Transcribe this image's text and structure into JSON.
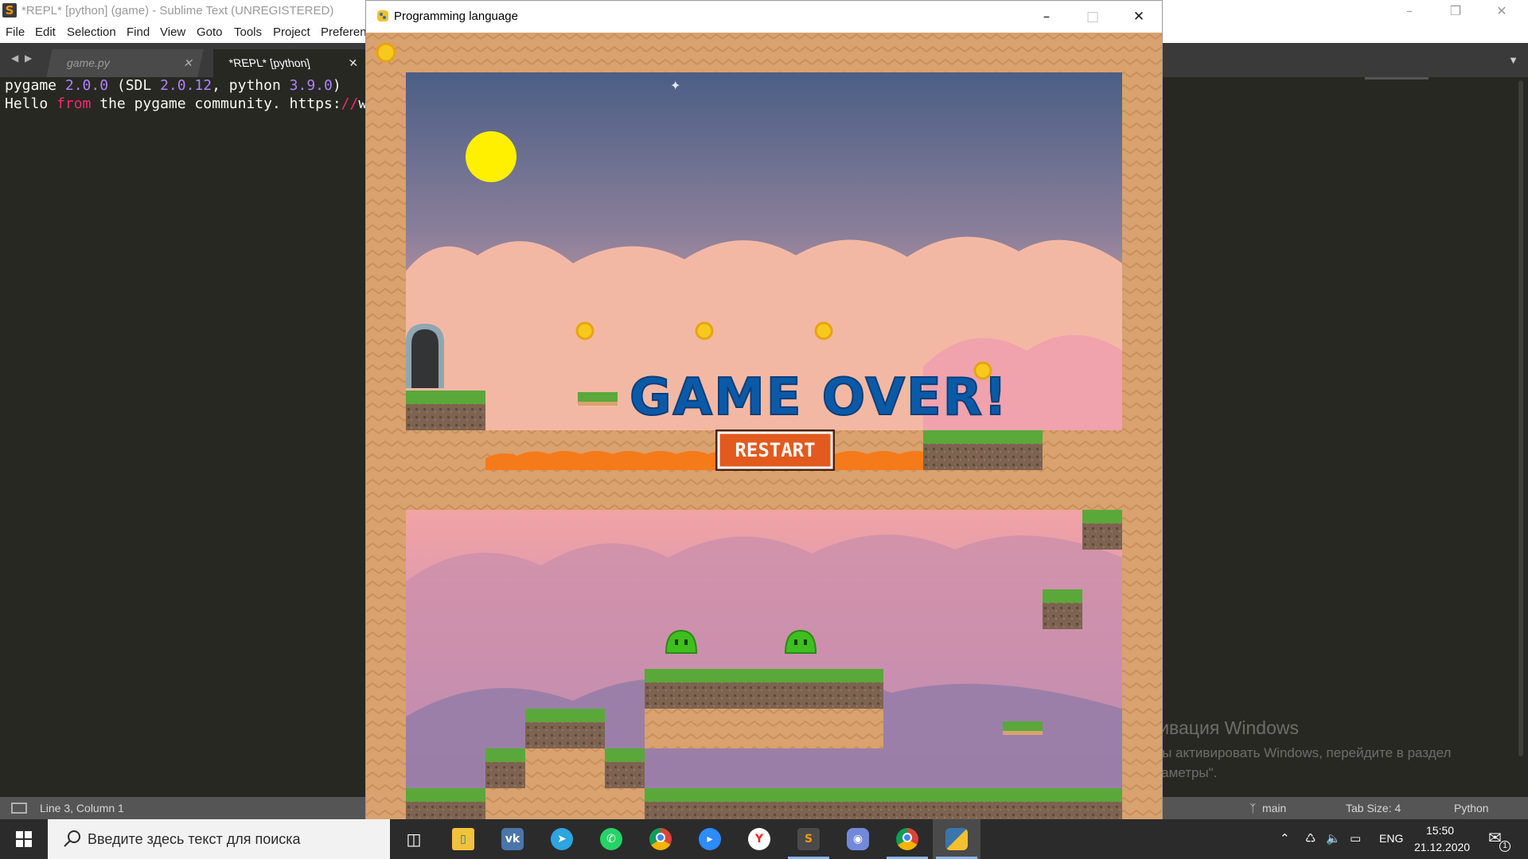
{
  "sublime": {
    "window_title": "*REPL* [python] (game) - Sublime Text (UNREGISTERED)",
    "menu": [
      "File",
      "Edit",
      "Selection",
      "Find",
      "View",
      "Goto",
      "Tools",
      "Project",
      "Preferen"
    ],
    "tabs": [
      {
        "label": "game.py",
        "active": false
      },
      {
        "label": "*REPL* [python]",
        "active": true
      }
    ],
    "code": {
      "line1": {
        "t1": "pygame ",
        "n1": "2.0.0",
        "t2": " (SDL ",
        "n2": "2.0.12",
        "t3": ", python ",
        "n3": "3.9.0",
        "t4": ")"
      },
      "line2": {
        "t1": "Hello ",
        "k1": "from",
        "t2": " the pygame community. https:",
        "k2": "//",
        "t3": "www"
      }
    },
    "status": {
      "position": "Line 3, Column 1",
      "branch": "main",
      "tab_size": "Tab Size: 4",
      "syntax": "Python"
    },
    "colors": {
      "editor_bg": "#272822",
      "keyword": "#f92672",
      "number": "#ae81ff"
    }
  },
  "watermark": {
    "title": "Активация Windows",
    "line1": "Чтобы активировать Windows, перейдите в раздел",
    "line2": "\"Параметры\"."
  },
  "game": {
    "window_title": "Programming language",
    "game_over_text": "GAME OVER!",
    "restart_label": "RESTART",
    "colors": {
      "sky_top": "#4b5e85",
      "sun": "#fff000",
      "lava": "#f57a1a",
      "game_over": "#0b5aa8",
      "wall": "#d8a06c"
    }
  },
  "taskbar": {
    "search_placeholder": "Введите здесь текст для поиска",
    "apps": [
      "task-view-icon",
      "file-explorer-icon",
      "vk-icon",
      "telegram-icon",
      "whatsapp-icon",
      "chrome-icon",
      "zoom-icon",
      "yandex-browser-icon",
      "sublime-text-icon",
      "discord-icon",
      "chrome-profile-icon",
      "python-icon"
    ],
    "language": "ENG",
    "time": "15:50",
    "date": "21.12.2020",
    "notification_count": "1"
  }
}
